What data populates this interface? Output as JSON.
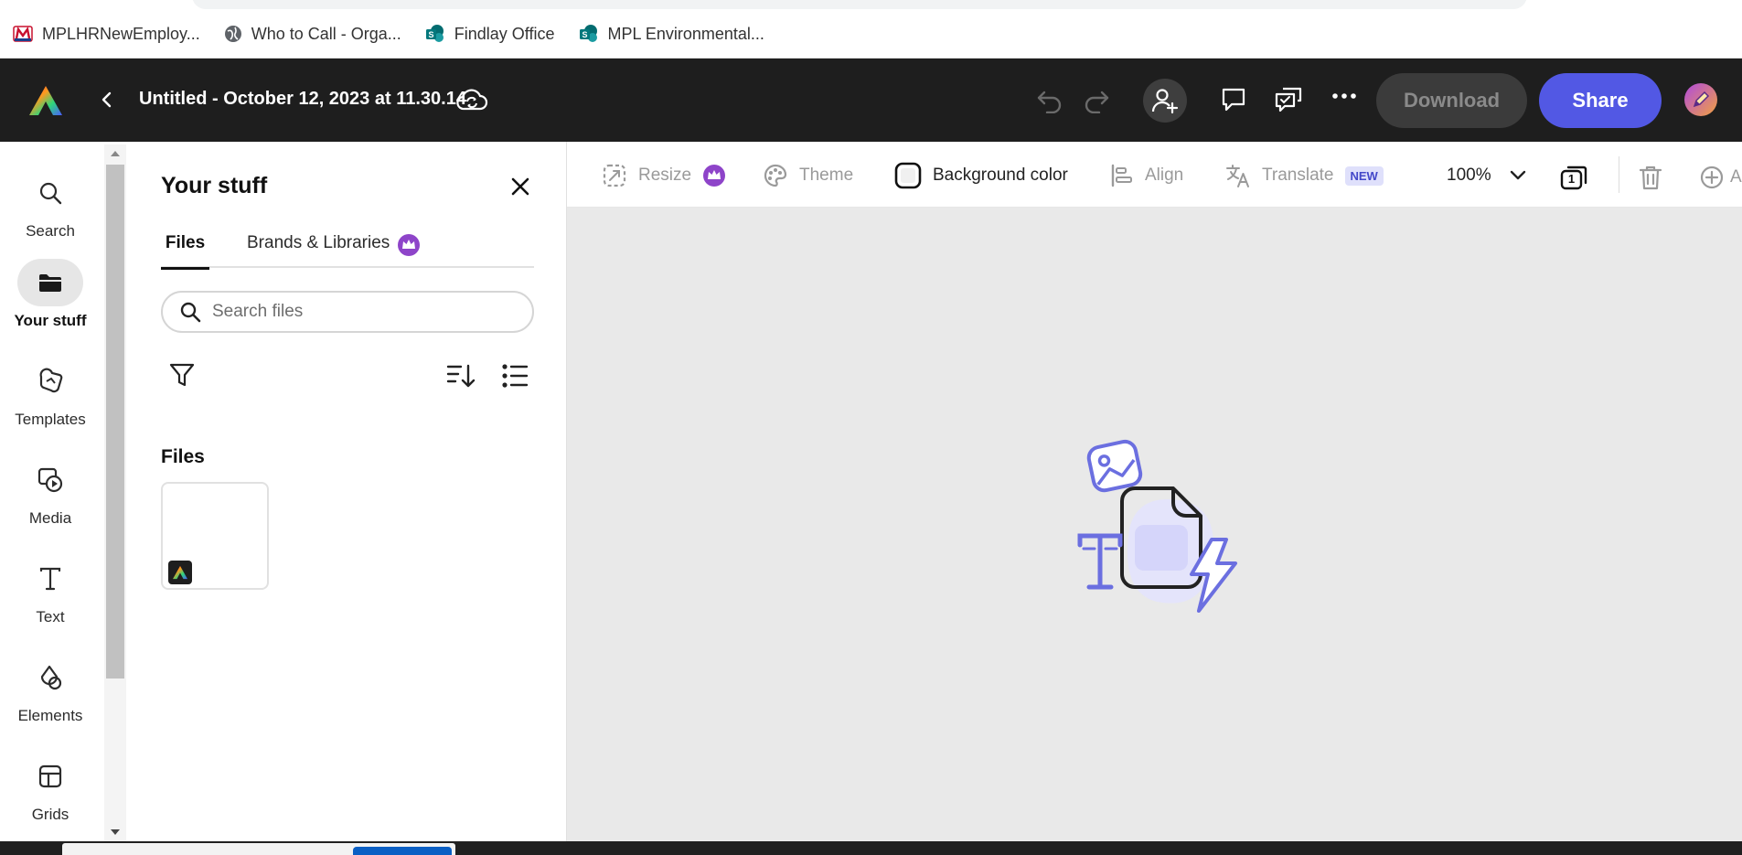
{
  "bookmarks": [
    {
      "label": "MPLHRNewEmploy...",
      "icon": "marathon-logo-icon"
    },
    {
      "label": "Who to Call - Orga...",
      "icon": "globe-icon"
    },
    {
      "label": "Findlay Office",
      "icon": "sharepoint-icon"
    },
    {
      "label": "MPL Environmental...",
      "icon": "sharepoint-icon"
    }
  ],
  "header": {
    "doc_title": "Untitled - October 12, 2023 at 11.30.14",
    "download_label": "Download",
    "share_label": "Share"
  },
  "rail": [
    {
      "label": "Search",
      "icon": "search-icon"
    },
    {
      "label": "Your stuff",
      "icon": "folder-icon",
      "active": true
    },
    {
      "label": "Templates",
      "icon": "templates-icon"
    },
    {
      "label": "Media",
      "icon": "media-icon"
    },
    {
      "label": "Text",
      "icon": "text-icon"
    },
    {
      "label": "Elements",
      "icon": "elements-icon"
    },
    {
      "label": "Grids",
      "icon": "grids-icon"
    }
  ],
  "panel": {
    "title": "Your stuff",
    "tabs": [
      "Files",
      "Brands & Libraries"
    ],
    "search_placeholder": "Search files",
    "files_heading": "Files"
  },
  "toolbar": {
    "resize": "Resize",
    "theme": "Theme",
    "background_color": "Background color",
    "align": "Align",
    "translate": "Translate",
    "translate_badge": "NEW",
    "zoom": "100%",
    "page_count": "1",
    "add_label": "A"
  },
  "colors": {
    "accent": "#5258e4",
    "premium": "#8e44c9",
    "header_bg": "#1e1e1e",
    "illustration": "#6b6fe0"
  }
}
